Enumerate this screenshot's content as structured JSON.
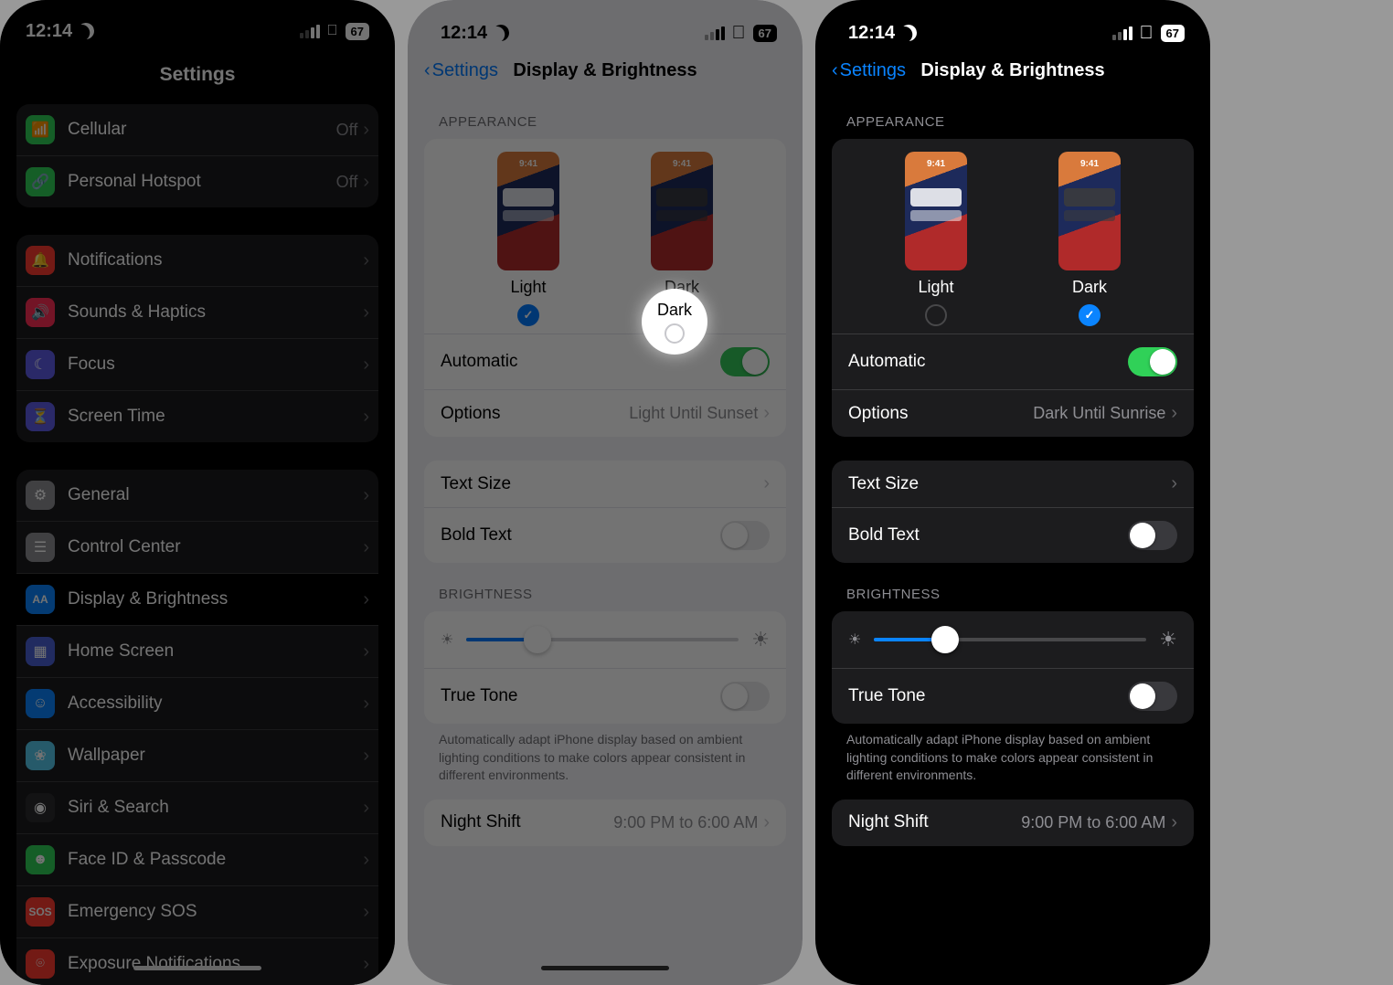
{
  "status": {
    "time": "12:14",
    "battery": "67"
  },
  "panel1": {
    "title": "Settings",
    "groups": [
      [
        {
          "icon": "cellular-icon",
          "cls": "ic-cell",
          "label": "Cellular",
          "value": "Off"
        },
        {
          "icon": "hotspot-icon",
          "cls": "ic-hot",
          "label": "Personal Hotspot",
          "value": "Off"
        }
      ],
      [
        {
          "icon": "bell-icon",
          "cls": "ic-noti",
          "label": "Notifications"
        },
        {
          "icon": "speaker-icon",
          "cls": "ic-snd",
          "label": "Sounds & Haptics"
        },
        {
          "icon": "moon-icon",
          "cls": "ic-focus",
          "label": "Focus"
        },
        {
          "icon": "hourglass-icon",
          "cls": "ic-scrt",
          "label": "Screen Time"
        }
      ],
      [
        {
          "icon": "gear-icon",
          "cls": "ic-gen",
          "label": "General"
        },
        {
          "icon": "switches-icon",
          "cls": "ic-cc",
          "label": "Control Center"
        },
        {
          "icon": "aa-icon",
          "cls": "ic-disp",
          "label": "Display & Brightness",
          "highlighted": true
        },
        {
          "icon": "grid-icon",
          "cls": "ic-home",
          "label": "Home Screen"
        },
        {
          "icon": "person-icon",
          "cls": "ic-acc",
          "label": "Accessibility"
        },
        {
          "icon": "flower-icon",
          "cls": "ic-wall",
          "label": "Wallpaper"
        },
        {
          "icon": "siri-icon",
          "cls": "ic-siri",
          "label": "Siri & Search"
        },
        {
          "icon": "faceid-icon",
          "cls": "ic-face",
          "label": "Face ID & Passcode"
        },
        {
          "icon": "sos-icon",
          "cls": "ic-sos",
          "label": "Emergency SOS"
        },
        {
          "icon": "virus-icon",
          "cls": "ic-exp",
          "label": "Exposure Notifications"
        }
      ]
    ]
  },
  "panel2": {
    "back": "Settings",
    "title": "Display & Brightness",
    "appearance_header": "APPEARANCE",
    "light": "Light",
    "dark": "Dark",
    "selected": "light",
    "automatic": "Automatic",
    "automatic_on": true,
    "options": "Options",
    "options_value": "Light Until Sunset",
    "text_size": "Text Size",
    "bold_text": "Bold Text",
    "bold_on": false,
    "brightness_header": "BRIGHTNESS",
    "brightness_pct": 26,
    "true_tone": "True Tone",
    "true_tone_on": false,
    "true_tone_note": "Automatically adapt iPhone display based on ambient lighting conditions to make colors appear consistent in different environments.",
    "night_shift": "Night Shift",
    "night_shift_value": "9:00 PM to 6:00 AM",
    "tap_highlight_label": "Dark"
  },
  "panel3": {
    "back": "Settings",
    "title": "Display & Brightness",
    "appearance_header": "APPEARANCE",
    "light": "Light",
    "dark": "Dark",
    "selected": "dark",
    "automatic": "Automatic",
    "automatic_on": true,
    "options": "Options",
    "options_value": "Dark Until Sunrise",
    "text_size": "Text Size",
    "bold_text": "Bold Text",
    "bold_on": false,
    "brightness_header": "BRIGHTNESS",
    "brightness_pct": 26,
    "true_tone": "True Tone",
    "true_tone_on": false,
    "true_tone_note": "Automatically adapt iPhone display based on ambient lighting conditions to make colors appear consistent in different environments.",
    "night_shift": "Night Shift",
    "night_shift_value": "9:00 PM to 6:00 AM"
  }
}
